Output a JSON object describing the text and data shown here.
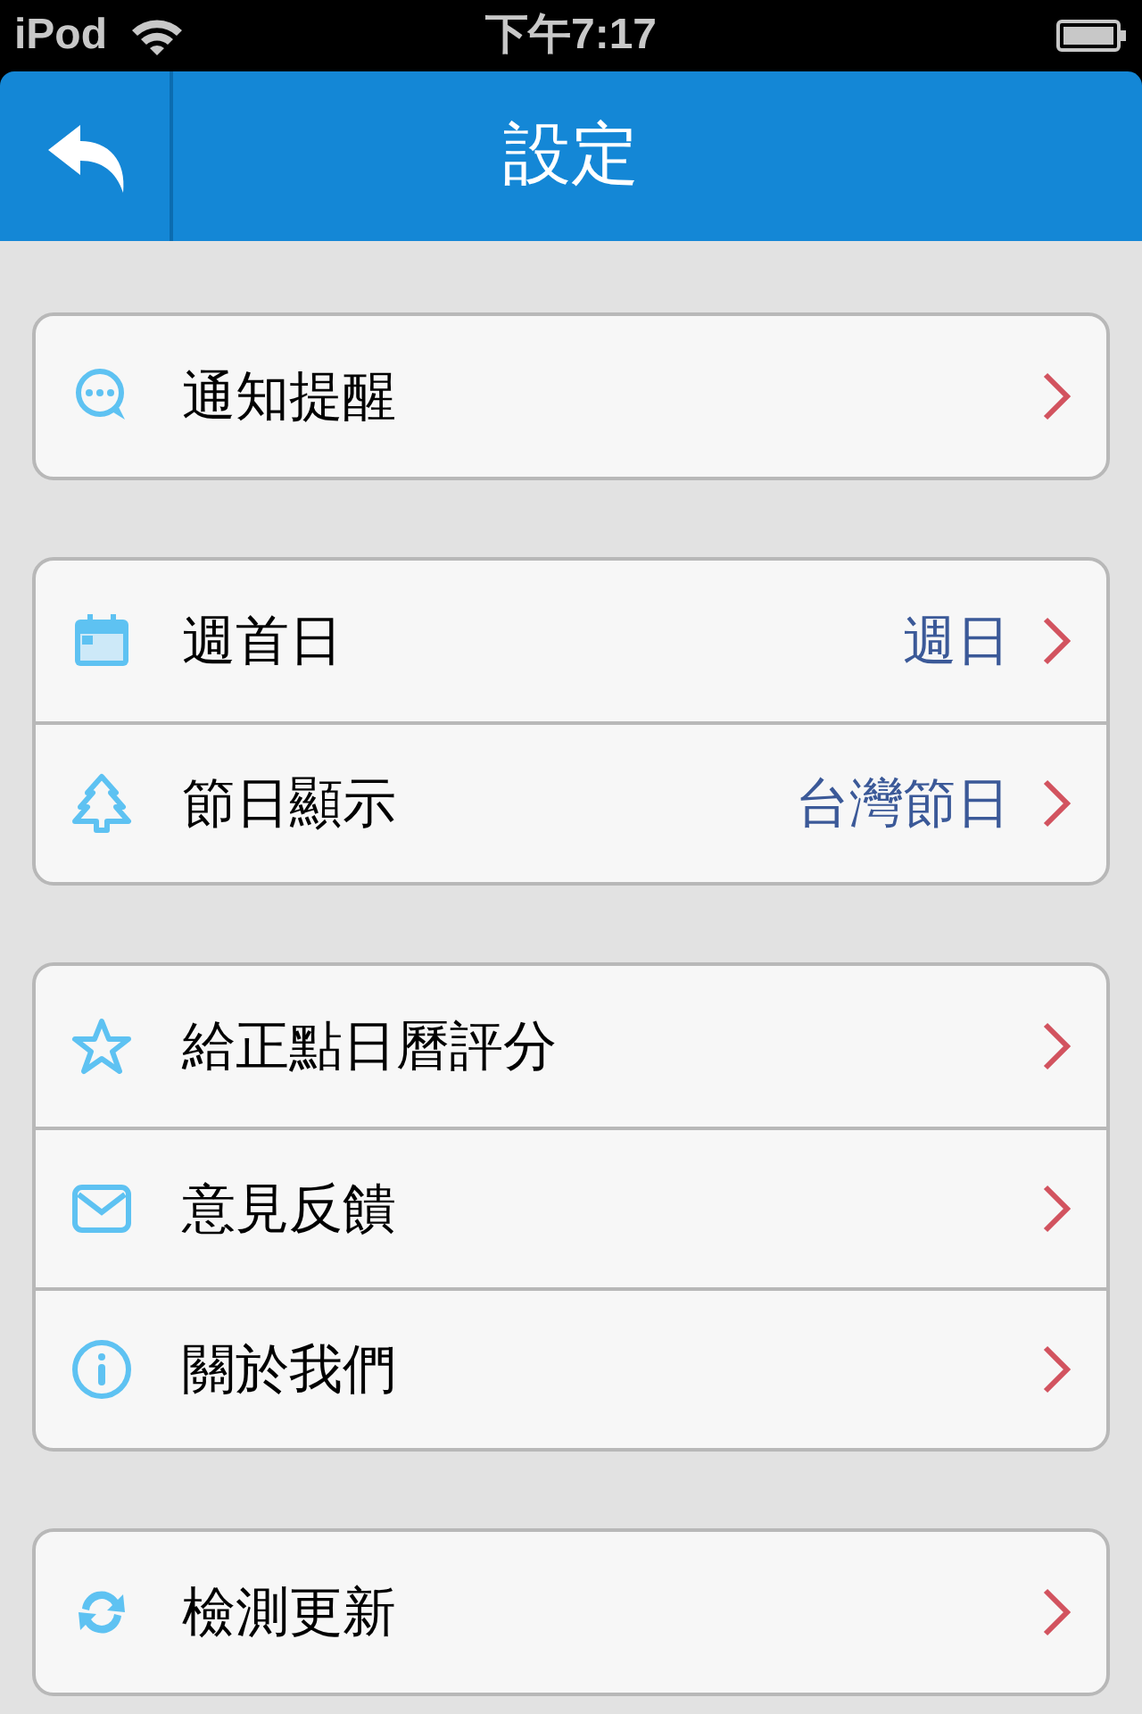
{
  "status_bar": {
    "carrier": "iPod",
    "time": "下午7:17"
  },
  "header": {
    "title": "設定"
  },
  "groups": [
    {
      "items": [
        {
          "label": "通知提醒"
        }
      ]
    },
    {
      "items": [
        {
          "label": "週首日",
          "value": "週日"
        },
        {
          "label": "節日顯示",
          "value": "台灣節日"
        }
      ]
    },
    {
      "items": [
        {
          "label": "給正點日曆評分"
        },
        {
          "label": "意見反饋"
        },
        {
          "label": "關於我們"
        }
      ]
    },
    {
      "items": [
        {
          "label": "檢測更新"
        }
      ]
    }
  ]
}
